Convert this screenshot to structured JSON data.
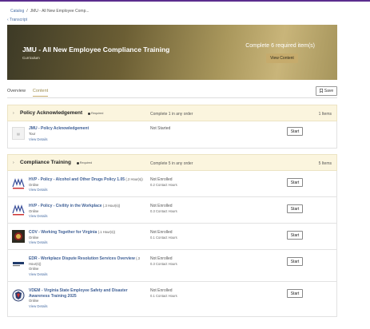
{
  "breadcrumb": {
    "catalog": "Catalog",
    "separator": "/",
    "current": "JMU - All New Employee Comp..."
  },
  "back_link": "Transcript",
  "banner": {
    "title": "JMU - All New Employee Compliance Training",
    "subtitle": "Curriculum",
    "required_text": "Complete 6 required item(s)",
    "view_button": "View Content"
  },
  "tabs": [
    {
      "label": "Overview"
    },
    {
      "label": "Content"
    }
  ],
  "save_label": "Save",
  "sections": [
    {
      "name": "Policy Acknowledgement",
      "badge": "Required",
      "rule": "Complete 1 in any order",
      "count": "1 Items",
      "items": [
        {
          "title": "JMU - Policy Acknowledgement",
          "hours": "",
          "type": "Tour",
          "details": "View Details",
          "status": "Not Started",
          "contact_hours": "",
          "action": "Start"
        }
      ]
    },
    {
      "name": "Compliance Training",
      "badge": "Required",
      "rule": "Complete 5 in any order",
      "count": "5 Items",
      "items": [
        {
          "title": "HVP - Policy - Alcohol and Other Drugs Policy 1.05",
          "hours": "(.2 Hour(s))",
          "type": "Online",
          "details": "View Details",
          "status": "Not Enrolled",
          "contact_hours": "0.2 Contact Hours",
          "action": "Start"
        },
        {
          "title": "HVP - Policy - Civility in the Workplace",
          "hours": "(.3 Hour(s))",
          "type": "Online",
          "details": "View Details",
          "status": "Not Enrolled",
          "contact_hours": "0.3 Contact Hours",
          "action": "Start"
        },
        {
          "title": "COV - Working Together for Virginia",
          "hours": "(.1 Hour(s))",
          "type": "Online",
          "details": "View Details",
          "status": "Not Enrolled",
          "contact_hours": "0.1 Contact Hours",
          "action": "Start"
        },
        {
          "title": "EDR - Workplace Dispute Resolution Services Overview",
          "hours": "(.3 Hour(s))",
          "type": "Online",
          "details": "View Details",
          "status": "Not Enrolled",
          "contact_hours": "0.3 Contact Hours",
          "action": "Start"
        },
        {
          "title": "VDEM - Virginia State Employee Safety and Disaster Awareness Training 2025",
          "hours": "",
          "type": "Online",
          "details": "View Details",
          "status": "Not Enrolled",
          "contact_hours": "0.1 Contact Hours",
          "action": "Start"
        }
      ]
    }
  ],
  "colors": {
    "accent": "#c6ab6c",
    "section_bg": "#fbf5de",
    "link": "#3e5f95",
    "topline": "#5b2d8e"
  }
}
